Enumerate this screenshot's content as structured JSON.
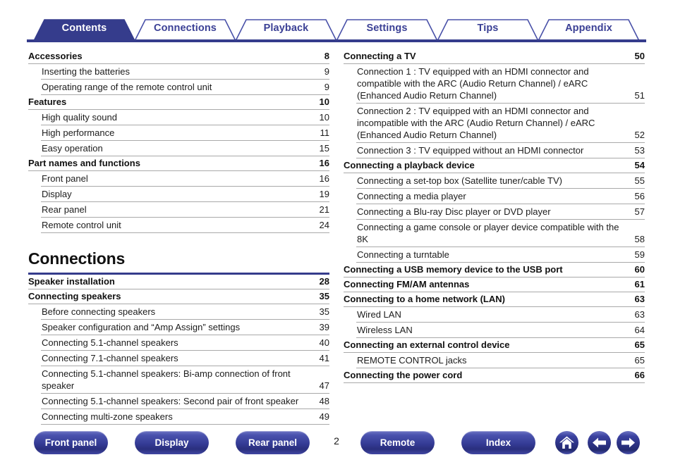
{
  "tabs": [
    {
      "label": "Contents",
      "active": true
    },
    {
      "label": "Connections",
      "active": false
    },
    {
      "label": "Playback",
      "active": false
    },
    {
      "label": "Settings",
      "active": false
    },
    {
      "label": "Tips",
      "active": false
    },
    {
      "label": "Appendix",
      "active": false
    }
  ],
  "colors": {
    "navy": "#353c8c",
    "tab_text_inactive": "#3b4095",
    "tab_text_active": "#ffffff",
    "rule": "#a9a9a9"
  },
  "left_column": {
    "entries": [
      {
        "level": 1,
        "title": "Accessories",
        "page": "8"
      },
      {
        "level": 2,
        "title": "Inserting the batteries",
        "page": "9"
      },
      {
        "level": 2,
        "title": "Operating range of the remote control unit",
        "page": "9"
      },
      {
        "level": 1,
        "title": "Features",
        "page": "10"
      },
      {
        "level": 2,
        "title": "High quality sound",
        "page": "10"
      },
      {
        "level": 2,
        "title": "High performance",
        "page": "11"
      },
      {
        "level": 2,
        "title": "Easy operation",
        "page": "15"
      },
      {
        "level": 1,
        "title": "Part names and functions",
        "page": "16"
      },
      {
        "level": 2,
        "title": "Front panel",
        "page": "16"
      },
      {
        "level": 2,
        "title": "Display",
        "page": "19"
      },
      {
        "level": 2,
        "title": "Rear panel",
        "page": "21"
      },
      {
        "level": 2,
        "title": "Remote control unit",
        "page": "24"
      }
    ],
    "section_heading": "Connections",
    "section_entries": [
      {
        "level": 1,
        "title": "Speaker installation",
        "page": "28"
      },
      {
        "level": 1,
        "title": "Connecting speakers",
        "page": "35"
      },
      {
        "level": 2,
        "title": "Before connecting speakers",
        "page": "35"
      },
      {
        "level": 2,
        "title": "Speaker configuration and “Amp Assign” settings",
        "page": "39"
      },
      {
        "level": 2,
        "title": "Connecting 5.1-channel speakers",
        "page": "40"
      },
      {
        "level": 2,
        "title": "Connecting 7.1-channel speakers",
        "page": "41"
      },
      {
        "level": 2,
        "title": "Connecting 5.1-channel speakers: Bi-amp connection of front speaker",
        "page": "47"
      },
      {
        "level": 2,
        "title": "Connecting 5.1-channel speakers: Second pair of front speaker",
        "page": "48"
      },
      {
        "level": 2,
        "title": "Connecting multi-zone speakers",
        "page": "49"
      }
    ]
  },
  "right_column": {
    "entries": [
      {
        "level": 1,
        "title": "Connecting a TV",
        "page": "50"
      },
      {
        "level": 2,
        "title": "Connection 1 : TV equipped with an HDMI connector and compatible with the ARC (Audio Return Channel) / eARC (Enhanced Audio Return Channel)",
        "page": "51"
      },
      {
        "level": 2,
        "title": "Connection 2 : TV equipped with an HDMI connector and incompatible with the ARC (Audio Return Channel) / eARC (Enhanced Audio Return Channel)",
        "page": "52"
      },
      {
        "level": 2,
        "title": "Connection 3 : TV equipped without an HDMI connector",
        "page": "53"
      },
      {
        "level": 1,
        "title": "Connecting a playback device",
        "page": "54"
      },
      {
        "level": 2,
        "title": "Connecting a set-top box (Satellite tuner/cable TV)",
        "page": "55"
      },
      {
        "level": 2,
        "title": "Connecting a media player",
        "page": "56"
      },
      {
        "level": 2,
        "title": "Connecting a Blu-ray Disc player or DVD player",
        "page": "57"
      },
      {
        "level": 2,
        "title": "Connecting a game console or player device compatible with the 8K",
        "page": "58"
      },
      {
        "level": 2,
        "title": "Connecting a turntable",
        "page": "59"
      },
      {
        "level": 1,
        "title": "Connecting a USB memory device to the USB port",
        "page": "60"
      },
      {
        "level": 1,
        "title": "Connecting FM/AM antennas",
        "page": "61"
      },
      {
        "level": 1,
        "title": "Connecting to a home network (LAN)",
        "page": "63"
      },
      {
        "level": 2,
        "title": "Wired LAN",
        "page": "63"
      },
      {
        "level": 2,
        "title": "Wireless LAN",
        "page": "64"
      },
      {
        "level": 1,
        "title": "Connecting an external control device",
        "page": "65"
      },
      {
        "level": 2,
        "title": "REMOTE CONTROL jacks",
        "page": "65"
      },
      {
        "level": 1,
        "title": "Connecting the power cord",
        "page": "66"
      }
    ]
  },
  "footer": {
    "buttons": [
      {
        "label": "Front panel"
      },
      {
        "label": "Display"
      },
      {
        "label": "Rear panel"
      },
      {
        "label": "Remote"
      },
      {
        "label": "Index"
      }
    ],
    "page_number": "2",
    "icons": [
      {
        "name": "home-icon"
      },
      {
        "name": "arrow-left-icon"
      },
      {
        "name": "arrow-right-icon"
      }
    ]
  }
}
